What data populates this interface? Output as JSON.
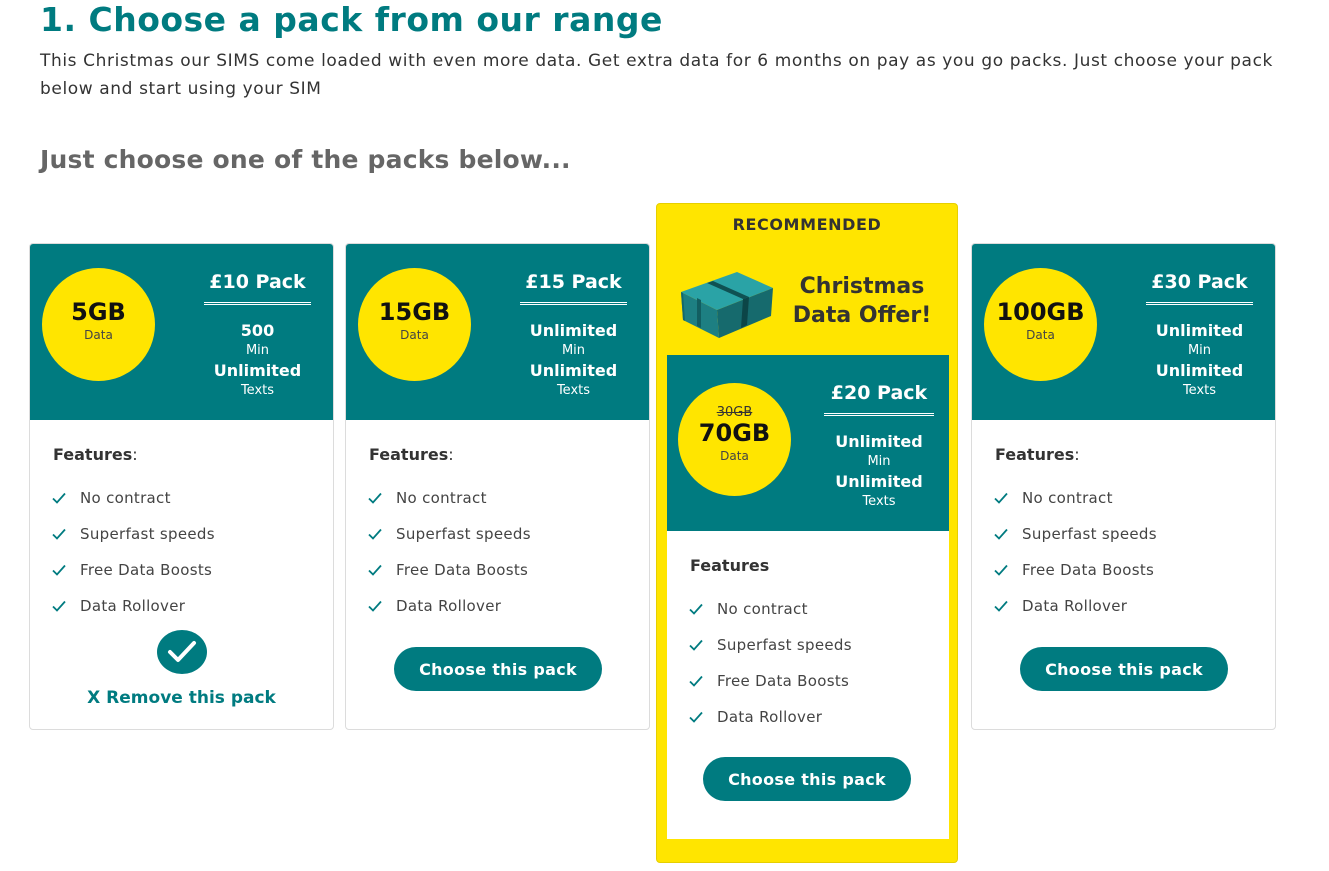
{
  "page": {
    "title": "1. Choose a pack from our range",
    "intro": "This Christmas our SIMS come loaded with even more data. Get extra data for 6 months on pay as you go packs. Just choose your pack below and start using your SIM",
    "subheading": "Just choose one of the packs below..."
  },
  "colors": {
    "brand_teal": "#007b80",
    "accent_yellow": "#ffe500"
  },
  "icons": {
    "feature_check": "check-icon",
    "selected": "check-circle-icon",
    "gift": "gift-icon"
  },
  "packs": [
    {
      "data_amount": "5GB",
      "data_label": "Data",
      "name": "£10 Pack",
      "minutes_value": "500",
      "minutes_label": "Min",
      "texts_value": "Unlimited",
      "texts_label": "Texts",
      "features_title": "Features",
      "features_colon": ":",
      "features": [
        "No contract",
        "Superfast speeds",
        "Free Data Boosts",
        "Data Rollover"
      ],
      "selected": true,
      "remove_label": "X Remove this pack"
    },
    {
      "data_amount": "15GB",
      "data_label": "Data",
      "name": "£15 Pack",
      "minutes_value": "Unlimited",
      "minutes_label": "Min",
      "texts_value": "Unlimited",
      "texts_label": "Texts",
      "features_title": "Features",
      "features_colon": ":",
      "features": [
        "No contract",
        "Superfast speeds",
        "Free Data Boosts",
        "Data Rollover"
      ],
      "button_label": "Choose this pack"
    },
    {
      "recommended_label": "RECOMMENDED",
      "offer_title_line1": "Christmas",
      "offer_title_line2": "Data Offer!",
      "old_data_amount": "30GB",
      "data_amount": "70GB",
      "data_label": "Data",
      "name": "£20 Pack",
      "minutes_value": "Unlimited",
      "minutes_label": "Min",
      "texts_value": "Unlimited",
      "texts_label": "Texts",
      "features_title": "Features",
      "features": [
        "No contract",
        "Superfast speeds",
        "Free Data Boosts",
        "Data Rollover"
      ],
      "button_label": "Choose this pack"
    },
    {
      "data_amount": "100GB",
      "data_label": "Data",
      "name": "£30 Pack",
      "minutes_value": "Unlimited",
      "minutes_label": "Min",
      "texts_value": "Unlimited",
      "texts_label": "Texts",
      "features_title": "Features",
      "features_colon": ":",
      "features": [
        "No contract",
        "Superfast speeds",
        "Free Data Boosts",
        "Data Rollover"
      ],
      "button_label": "Choose this pack"
    }
  ]
}
